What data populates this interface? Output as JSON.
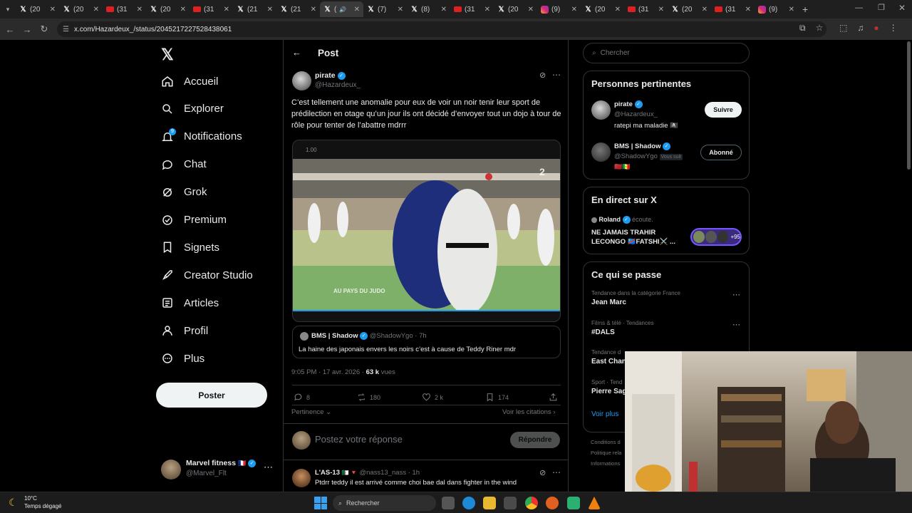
{
  "browser": {
    "tabs": [
      {
        "icon": "x",
        "label": "(20"
      },
      {
        "icon": "x",
        "label": "(20"
      },
      {
        "icon": "yt",
        "label": "(31"
      },
      {
        "icon": "x",
        "label": "(20"
      },
      {
        "icon": "yt",
        "label": "(31"
      },
      {
        "icon": "x",
        "label": "(21"
      },
      {
        "icon": "x",
        "label": "(21"
      },
      {
        "icon": "x",
        "label": "(",
        "active": true
      },
      {
        "icon": "x",
        "label": "(7)"
      },
      {
        "icon": "x",
        "label": "(8)"
      },
      {
        "icon": "yt",
        "label": "(31"
      },
      {
        "icon": "x",
        "label": "(20"
      },
      {
        "icon": "ig",
        "label": "(9)"
      },
      {
        "icon": "x",
        "label": "(20"
      },
      {
        "icon": "yt",
        "label": "(31"
      },
      {
        "icon": "x",
        "label": "(20"
      },
      {
        "icon": "yt",
        "label": "(31"
      },
      {
        "icon": "ig",
        "label": "(9)"
      }
    ],
    "url": "x.com/Hazardeux_/status/2045217227528438061"
  },
  "sidebar": {
    "items": [
      {
        "label": "Accueil",
        "icon": "home-icon"
      },
      {
        "label": "Explorer",
        "icon": "search-icon"
      },
      {
        "label": "Notifications",
        "icon": "bell-icon",
        "badge": "9"
      },
      {
        "label": "Chat",
        "icon": "chat-icon"
      },
      {
        "label": "Grok",
        "icon": "grok-icon"
      },
      {
        "label": "Premium",
        "icon": "premium-icon"
      },
      {
        "label": "Signets",
        "icon": "bookmark-icon"
      },
      {
        "label": "Creator Studio",
        "icon": "rocket-icon"
      },
      {
        "label": "Articles",
        "icon": "article-icon"
      },
      {
        "label": "Profil",
        "icon": "person-icon"
      },
      {
        "label": "Plus",
        "icon": "more-circle-icon"
      }
    ],
    "post_button": "Poster",
    "account": {
      "name": "Marvel fitness",
      "flag": "🇫🇷",
      "handle": "@Marvel_Flt"
    }
  },
  "main": {
    "header": "Post",
    "tweet": {
      "author": "pirate",
      "handle": "@Hazardeux_",
      "text": "C’est tellement une anomalie pour eux de voir un noir  tenir leur sport de prédilection en otage qu’un jour ils ont décidé d’envoyer tout un dojo à tour de rôle pour tenter de l’abattre mdrrr",
      "video": {
        "time_label": "1.00",
        "watermark": "AU PAYS DU JUDO",
        "channel_number": "2"
      },
      "quote": {
        "author": "BMS | Shadow",
        "handle": "@ShadowYgo",
        "time": "· 7h",
        "text": "La haine des japonais envers les noirs c’est à cause de Teddy Riner mdr"
      },
      "timestamp": "9:05 PM · 17 avr. 2026 ·",
      "views_count": "63 k",
      "views_label": "vues",
      "stats": {
        "replies": "8",
        "reposts": "180",
        "likes": "2 k",
        "bookmarks": "174"
      }
    },
    "sort_label": "Pertinence",
    "quotes_link": "Voir les citations",
    "reply_placeholder": "Postez votre réponse",
    "reply_button": "Répondre",
    "next_reply": {
      "author": "L'AS-13",
      "flags": "🇩🇿 🔻",
      "handle": "@nass13_nass",
      "time": "· 1h",
      "text": "Ptdrr teddy il est arrivé comme choi bae dal dans fighter in the wind"
    }
  },
  "right": {
    "search_placeholder": "Chercher",
    "relevant": {
      "title": "Personnes pertinentes",
      "people": [
        {
          "name": "pirate",
          "handle": "@Hazardeux_",
          "bio": "ratepi ma maladie 🏴‍☠️",
          "button": "Suivre"
        },
        {
          "name": "BMS | Shadow",
          "handle": "@ShadowYgo",
          "follows_you": "Vous suit",
          "bio": "🇲🇦🇸🇳",
          "button": "Abonné"
        }
      ]
    },
    "live": {
      "title": "En direct sur X",
      "host": "Roland",
      "host_status": "écoute.",
      "space_title": "NE JAMAIS TRAHIR LECONGO 🇨🇩FATSHI⚔️ ...",
      "listeners": "+95"
    },
    "trends": {
      "title": "Ce qui se passe",
      "items": [
        {
          "context": "Tendance dans la catégorie France",
          "name": "Jean Marc"
        },
        {
          "context": "Films & télé · Tendances",
          "name": "#DALS"
        },
        {
          "context": "Tendance d",
          "name": "East Chan"
        },
        {
          "context": "Sport · Tend",
          "name": "Pierre Sag"
        }
      ],
      "see_more": "Voir plus"
    },
    "footer": [
      "Conditions d",
      "Politique rela",
      "Informations"
    ]
  },
  "taskbar": {
    "weather_temp": "10°C",
    "weather_desc": "Temps dégagé",
    "search_placeholder": "Rechercher"
  }
}
